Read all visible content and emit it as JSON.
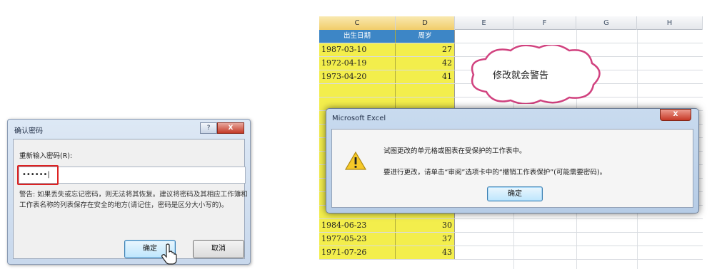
{
  "confirm_dialog": {
    "title": "确认密码",
    "window_controls": {
      "help": "?",
      "close": "X"
    },
    "prompt_label": "重新输入密码(R):",
    "password_value": "••••••|",
    "warning": "警告: 如果丢失或忘记密码，则无法将其恢复。建议将密码及其相应工作簿和工作表名称的列表保存在安全的地方(请记住，密码是区分大小写的)。",
    "ok_label": "确定",
    "cancel_label": "取消"
  },
  "spreadsheet": {
    "columns": [
      "C",
      "D",
      "E",
      "F",
      "G",
      "H"
    ],
    "selected_columns": [
      "C",
      "D"
    ],
    "header_row": {
      "date": "出生日期",
      "age": "周岁"
    },
    "rows": [
      {
        "date": "1987-03-10",
        "age": "27"
      },
      {
        "date": "1972-04-19",
        "age": "42"
      },
      {
        "date": "1973-04-20",
        "age": "41"
      },
      {
        "date": "1984-06-23",
        "age": "30"
      },
      {
        "date": "1977-05-23",
        "age": "37"
      },
      {
        "date": "1971-07-26",
        "age": "43"
      }
    ],
    "highlight_color": "#f3ee4c",
    "header_color": "#3d86c6"
  },
  "callout": {
    "text": "修改就会警告"
  },
  "alert_dialog": {
    "title": "Microsoft Excel",
    "close": "X",
    "icon": "warning-icon",
    "message1": "试图更改的单元格或图表在受保护的工作表中。",
    "message2": "要进行更改，请单击“审阅”选项卡中的“撤销工作表保护”(可能需要密码)。",
    "ok_label": "确定"
  }
}
